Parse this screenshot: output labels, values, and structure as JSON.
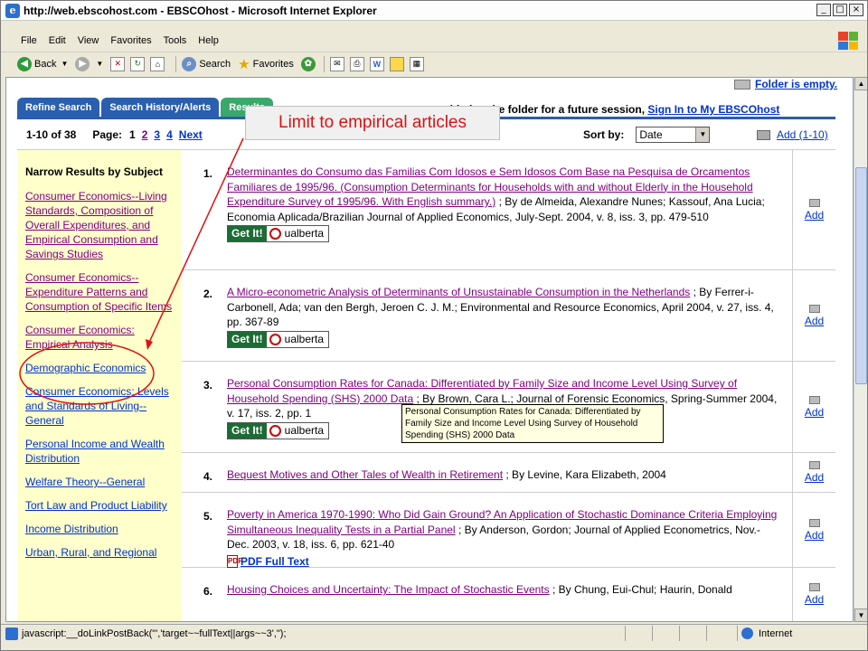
{
  "window": {
    "title": "http://web.ebscohost.com - EBSCOhost - Microsoft Internet Explorer",
    "controls": [
      "_",
      "□",
      "×"
    ]
  },
  "menu": [
    "File",
    "Edit",
    "View",
    "Favorites",
    "Tools",
    "Help"
  ],
  "toolbar": {
    "back": "Back",
    "search": "Search",
    "favorites": "Favorites"
  },
  "page": {
    "folder_empty": "Folder is empty.",
    "tabs": [
      "Refine Search",
      "Search History/Alerts",
      "Results"
    ],
    "folder_msg_prefix": "added to the folder for a future session,",
    "folder_msg_link": "Sign In to My EBSCOhost",
    "range": "1-10 of 38",
    "page_label": "Page:",
    "pages": [
      "1",
      "2",
      "3",
      "4"
    ],
    "next": "Next",
    "sort_label": "Sort by:",
    "sort_value": "Date",
    "add_all": "Add (1-10)"
  },
  "sidebar": {
    "heading": "Narrow Results by Subject",
    "subjects": [
      {
        "label": "Consumer Economics--Living Standards, Composition of Overall Expenditures, and Empirical Consumption and Savings Studies",
        "visited": true
      },
      {
        "label": "Consumer Economics--Expenditure Patterns and Consumption of Specific Items",
        "visited": true
      },
      {
        "label": "Consumer Economics: Empirical Analysis",
        "visited": true
      },
      {
        "label": "Demographic Economics",
        "visited": false
      },
      {
        "label": "Consumer Economics: Levels and Standards of Living--General",
        "visited": false
      },
      {
        "label": "Personal Income and Wealth Distribution",
        "visited": false
      },
      {
        "label": "Welfare Theory--General",
        "visited": false
      },
      {
        "label": "Tort Law and Product Liability",
        "visited": false
      },
      {
        "label": "Income Distribution",
        "visited": false
      },
      {
        "label": "Urban, Rural, and Regional",
        "visited": false
      }
    ]
  },
  "results": [
    {
      "num": "1.",
      "title": "Determinantes do Consumo das Familias Com Idosos e Sem Idosos Com Base na Pesquisa de Orcamentos Familiares de 1995/96. (Consumption Determinants for Households with and without Elderly in the Household Expenditure Survey of 1995/96. With English summary.)",
      "citation": "; By de Almeida, Alexandre Nunes; Kassouf, Ana Lucia; Economia Aplicada/Brazilian Journal of Applied Economics, July-Sept. 2004, v. 8, iss. 3, pp. 479-510",
      "getit": true,
      "pdf": false
    },
    {
      "num": "2.",
      "title": "A Micro-econometric Analysis of Determinants of Unsustainable Consumption in the Netherlands",
      "citation": "; By Ferrer-i-Carbonell, Ada; van den Bergh, Jeroen C. J. M.; Environmental and Resource Economics, April 2004, v. 27, iss. 4, pp. 367-89",
      "getit": true,
      "pdf": false
    },
    {
      "num": "3.",
      "title": "Personal Consumption Rates for Canada: Differentiated by Family Size and Income Level Using Survey of Household Spending (SHS) 2000 Data",
      "citation": "; By Brown, Cara L.; Journal of Forensic Economics, Spring-Summer 2004, v. 17, iss. 2, pp. 1",
      "getit": true,
      "pdf": false
    },
    {
      "num": "4.",
      "title": "Bequest Motives and Other Tales of Wealth in Retirement",
      "citation": "; By Levine, Kara Elizabeth, 2004",
      "getit": false,
      "pdf": false
    },
    {
      "num": "5.",
      "title": "Poverty in America 1970-1990: Who Did Gain Ground? An Application of Stochastic Dominance Criteria Employing Simultaneous Inequality Tests in a Partial Panel",
      "citation": "; By Anderson, Gordon; Journal of Applied Econometrics, Nov.-Dec. 2003, v. 18, iss. 6, pp. 621-40",
      "getit": false,
      "pdf": true
    },
    {
      "num": "6.",
      "title": "Housing Choices and Uncertainty: The Impact of Stochastic Events",
      "citation": "; By Chung, Eui-Chul; Haurin, Donald",
      "getit": false,
      "pdf": false
    }
  ],
  "getit_label": "Get It!",
  "ualberta_label": "ualberta",
  "pdf_label": "PDF Full Text",
  "add_label": "Add",
  "tooltip": "Personal Consumption Rates for Canada: Differentiated by Family Size and Income Level Using Survey of Household Spending (SHS) 2000 Data",
  "annotation": "Limit to empirical articles",
  "status": {
    "text": "javascript:__doLinkPostBack(\"','target~~fullText||args~~3',\");",
    "zone": "Internet"
  },
  "colors": {
    "tab_blue": "#2a5eae",
    "tab_active": "#3aa86b",
    "sidebar_bg": "#ffffcc",
    "annotation_red": "#e01010"
  }
}
